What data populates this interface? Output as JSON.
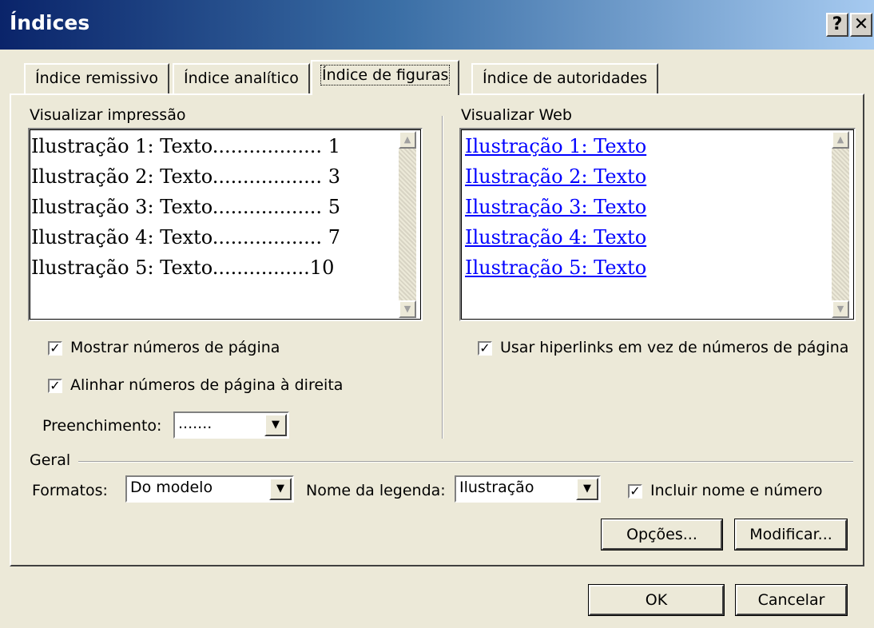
{
  "window": {
    "title": "Índices",
    "help_glyph": "?",
    "close_glyph": "✕"
  },
  "tabs": [
    {
      "label": "Índice remissivo"
    },
    {
      "label": "Índice analítico"
    },
    {
      "label": "Índice de figuras"
    },
    {
      "label": "Índice de autoridades"
    }
  ],
  "print_preview": {
    "label": "Visualizar impressão",
    "entries": [
      {
        "text": "Ilustração 1: Texto",
        "leader": "..................",
        "page": "1"
      },
      {
        "text": "Ilustração 2: Texto",
        "leader": "..................",
        "page": "3"
      },
      {
        "text": "Ilustração 3: Texto",
        "leader": "..................",
        "page": "5"
      },
      {
        "text": "Ilustração 4: Texto",
        "leader": "..................",
        "page": "7"
      },
      {
        "text": "Ilustração 5: Texto",
        "leader": "................",
        "page": "10"
      }
    ]
  },
  "web_preview": {
    "label": "Visualizar Web",
    "entries": [
      "Ilustração 1: Texto",
      "Ilustração 2: Texto",
      "Ilustração 3: Texto",
      "Ilustração 4: Texto",
      "Ilustração 5: Texto"
    ]
  },
  "options": {
    "show_page_numbers": {
      "label": "Mostrar números de página",
      "checked": true
    },
    "align_page_numbers": {
      "label": "Alinhar números de página à direita",
      "checked": true
    },
    "leader": {
      "label": "Preenchimento:",
      "value": "......."
    },
    "use_hyperlinks": {
      "label": "Usar hiperlinks em vez de números de página",
      "checked": true
    }
  },
  "general": {
    "label": "Geral",
    "formats": {
      "label": "Formatos:",
      "value": "Do modelo"
    },
    "caption_name": {
      "label": "Nome da legenda:",
      "value": "Ilustração"
    },
    "include_label": {
      "label": "Incluir nome e número",
      "checked": true
    }
  },
  "buttons": {
    "options": "Opções...",
    "modify": "Modificar...",
    "ok": "OK",
    "cancel": "Cancelar"
  },
  "glyphs": {
    "check": "✓",
    "down": "▼",
    "up": "▲"
  }
}
